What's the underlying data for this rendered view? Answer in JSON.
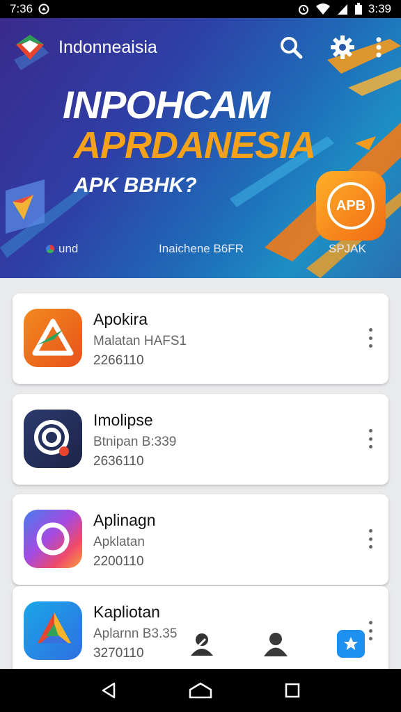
{
  "status_bar": {
    "time_left": "7:36",
    "time_right": "3:39"
  },
  "app_bar": {
    "title": "Indonneaisia"
  },
  "banner": {
    "headline_1": "INPOHCAM",
    "headline_2": "APRDANESIA",
    "headline_3": "APK BBHK?",
    "badge_text": "APB",
    "footer_left": "und",
    "footer_center": "Inaichene B6FR",
    "footer_right": "SPJAK"
  },
  "apps": [
    {
      "name": "Apokira",
      "subtitle": "Malatan HAFS1",
      "number": "2266110",
      "icon": "triangle-arrow-icon"
    },
    {
      "name": "Imolipse",
      "subtitle": "Btnipan B:339",
      "number": "2636110",
      "icon": "target-icon"
    },
    {
      "name": "Aplinagn",
      "subtitle": "Apklatan",
      "number": "2200110",
      "icon": "ring-icon"
    },
    {
      "name": "Kapliotan",
      "subtitle": "Aplarnn B3.35",
      "number": "3270110",
      "icon": "triangle-logo-icon"
    }
  ],
  "colors": {
    "accent_orange": "#f5a21a",
    "status_bar": "#000000",
    "fab_blue": "#1e90f0"
  }
}
